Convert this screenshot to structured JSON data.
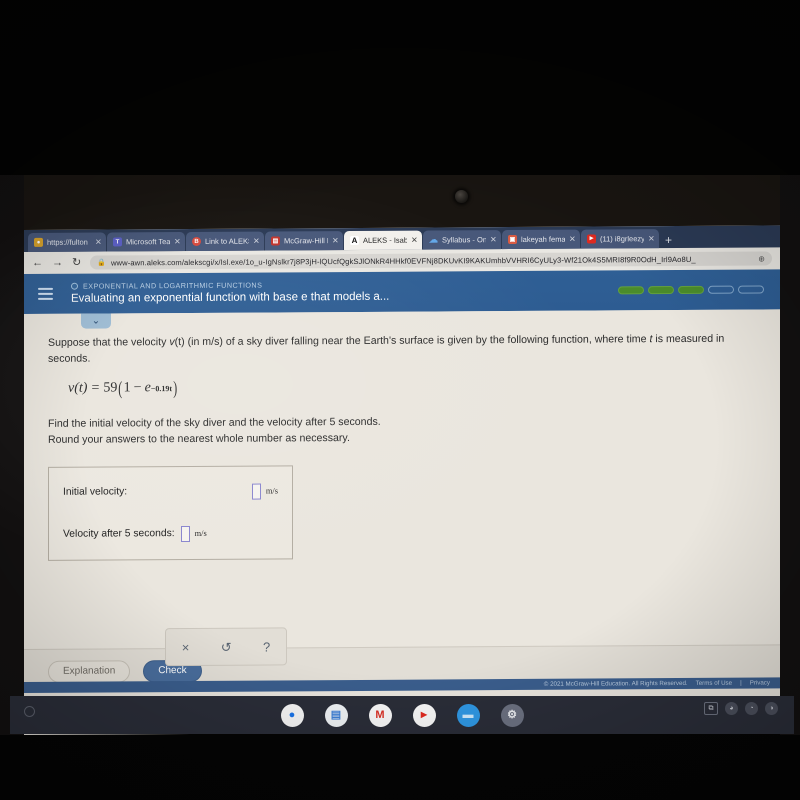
{
  "browser": {
    "tabs": [
      {
        "title": "https://fulton",
        "favicon": "globe-icon",
        "favicon_color": "#d8a22a",
        "favicon_glyph": "●",
        "active": false
      },
      {
        "title": "Microsoft Tea",
        "favicon": "microsoft-teams-icon",
        "favicon_color": "#5b5fc7",
        "favicon_glyph": "T",
        "active": false
      },
      {
        "title": "Link to ALEKS",
        "favicon": "link-icon",
        "favicon_color": "#d94a3d",
        "favicon_glyph": "B",
        "active": false
      },
      {
        "title": "McGraw-Hill E",
        "favicon": "mcgraw-hill-icon",
        "favicon_color": "#c2342c",
        "favicon_glyph": "▤",
        "active": false
      },
      {
        "title": "ALEKS - Isabel",
        "favicon": "aleks-icon",
        "favicon_color": "#ffffff",
        "favicon_glyph": "A",
        "active": true
      },
      {
        "title": "Syllabus - One",
        "favicon": "onedrive-icon",
        "favicon_color": "#2f84d8",
        "favicon_glyph": "☁",
        "active": false
      },
      {
        "title": "lakeyah fema",
        "favicon": "image-icon",
        "favicon_color": "#d95b43",
        "favicon_glyph": "▣",
        "active": false
      },
      {
        "title": "(11) i8grleezy",
        "favicon": "youtube-icon",
        "favicon_color": "#e02a20",
        "favicon_glyph": "▶",
        "active": false
      }
    ],
    "new_tab_label": "+",
    "nav": {
      "back_label": "←",
      "forward_label": "→",
      "reload_label": "↻"
    },
    "address": {
      "lock_glyph": "🔒",
      "url": "www-awn.aleks.com/alekscgi/x/Isl.exe/1o_u-IgNslkr7j8P3jH-lQUcfQgkSJlONkR4HHkf0EVFNj8DKUvKI9KAKUmhbVVHRI6CyULy3-Wf21Ok4S5MRI8f9R0OdH_Irl9Ao8U_",
      "zoom_glyph": "⊕"
    }
  },
  "aleks": {
    "menu_label": "hamburger-menu",
    "topic": "EXPONENTIAL AND LOGARITHMIC FUNCTIONS",
    "objective": "Evaluating an exponential function with base e that models a...",
    "progress": {
      "total": 5,
      "filled": 3
    },
    "collapse_glyph": "⌄"
  },
  "question": {
    "prompt_line1": "Suppose that the velocity",
    "prompt_v": "v",
    "prompt_t": "(t)",
    "prompt_line1b": "(in m/s) of a sky diver falling near the Earth's surface is given by the following function, where time",
    "prompt_var_t": "t",
    "prompt_line1c": "is measured in",
    "prompt_line2": "seconds.",
    "formula": {
      "lhs_v": "v",
      "lhs_t": "(t)",
      "equals": "=",
      "coefficient": "59",
      "open_paren": "(",
      "one": "1",
      "minus": "−",
      "e": "e",
      "exponent": "−0.19t",
      "close_paren": ")"
    },
    "instruction_line1": "Find the initial velocity of the sky diver and the velocity after 5 seconds.",
    "instruction_line2": "Round your answers to the nearest whole number as necessary.",
    "answers": [
      {
        "label": "Initial velocity:",
        "value": "",
        "unit": "m/s"
      },
      {
        "label": "Velocity after 5 seconds:",
        "value": "",
        "unit": "m/s"
      }
    ]
  },
  "toolbar": {
    "clear_glyph": "×",
    "undo_glyph": "↺",
    "help_glyph": "?"
  },
  "actions": {
    "explanation_label": "Explanation",
    "check_label": "Check"
  },
  "footer": {
    "copyright": "© 2021 McGraw-Hill Education. All Rights Reserved.",
    "terms_label": "Terms of Use",
    "separator": "|",
    "privacy_label": "Privacy"
  },
  "shelf": {
    "apps": [
      {
        "name": "chrome-icon",
        "glyph": "●",
        "color": "#f5f5f5",
        "fg": "#1a73e8"
      },
      {
        "name": "google-slides-icon",
        "glyph": "▤",
        "color": "#eef1f4",
        "fg": "#3d7fd6"
      },
      {
        "name": "gmail-icon",
        "glyph": "M",
        "color": "#f7f7f7",
        "fg": "#d93025"
      },
      {
        "name": "youtube-icon",
        "glyph": "▶",
        "color": "#f7f7f7",
        "fg": "#e02a20"
      },
      {
        "name": "files-icon",
        "glyph": "▬",
        "color": "#2f97e3",
        "fg": "#cfe9fb"
      },
      {
        "name": "settings-icon",
        "glyph": "⚙",
        "color": "#6b7080",
        "fg": "#e9ebef"
      }
    ],
    "tray": [
      {
        "name": "screenshot-icon",
        "glyph": "⧉"
      },
      {
        "name": "battery-icon",
        "glyph": "◕"
      },
      {
        "name": "wifi-icon",
        "glyph": "◔"
      },
      {
        "name": "clock-icon",
        "glyph": "◑"
      }
    ],
    "launcher_label": "launcher-button"
  },
  "colors": {
    "aleks_header": "#2f5f95",
    "progress_filled": "#4b8c2b",
    "check_button": "#496d9c",
    "page_bg": "#eae6de"
  }
}
